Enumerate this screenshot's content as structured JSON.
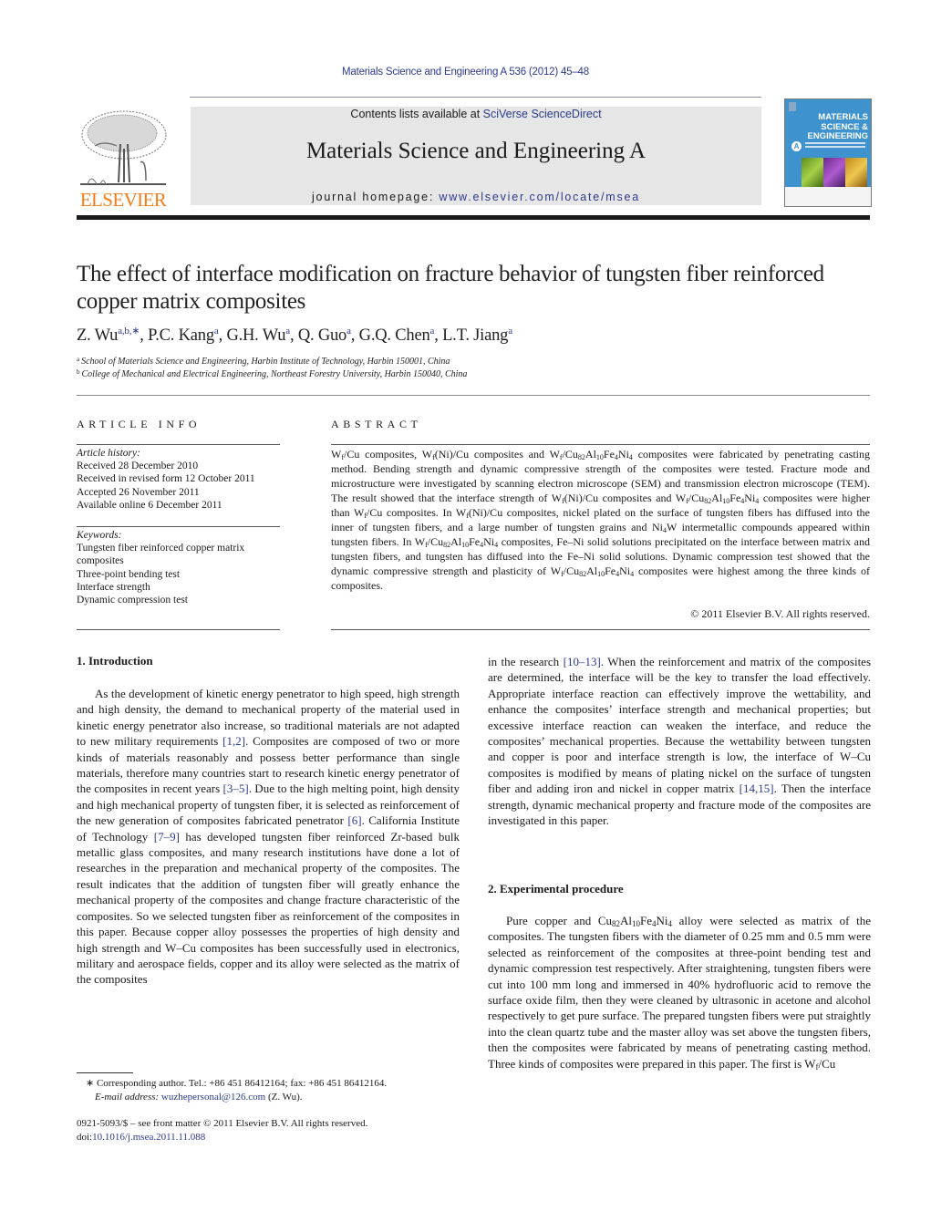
{
  "header": {
    "citation": "Materials Science and Engineering A 536 (2012) 45–48",
    "contents_prefix": "Contents lists available at ",
    "contents_link": "SciVerse ScienceDirect",
    "journal_name": "Materials Science and Engineering A",
    "homepage_prefix": "journal homepage: ",
    "homepage_link": "www.elsevier.com/locate/msea",
    "publisher_logo_text": "ELSEVIER",
    "cover": {
      "title_line1": "MATERIALS",
      "title_line2": "SCIENCE &",
      "title_line3": "ENGINEERING",
      "badge": "A"
    }
  },
  "article": {
    "title": "The effect of interface modification on fracture behavior of tungsten fiber reinforced copper matrix composites",
    "authors": [
      {
        "name": "Z. Wu",
        "sup": "a,b,∗"
      },
      {
        "name": "P.C. Kang",
        "sup": "a"
      },
      {
        "name": "G.H. Wu",
        "sup": "a"
      },
      {
        "name": "Q. Guo",
        "sup": "a"
      },
      {
        "name": "G.Q. Chen",
        "sup": "a"
      },
      {
        "name": "L.T. Jiang",
        "sup": "a"
      }
    ],
    "affiliations": [
      {
        "key": "a",
        "text": "School of Materials Science and Engineering, Harbin Institute of Technology, Harbin 150001, China"
      },
      {
        "key": "b",
        "text": "College of Mechanical and Electrical Engineering, Northeast Forestry University, Harbin 150040, China"
      }
    ]
  },
  "article_info": {
    "heading": "ARTICLE INFO",
    "history_label": "Article history:",
    "history": [
      "Received 28 December 2010",
      "Received in revised form 12 October 2011",
      "Accepted 26 November 2011",
      "Available online 6 December 2011"
    ],
    "keywords_label": "Keywords:",
    "keywords": [
      "Tungsten fiber reinforced copper matrix composites",
      "Three-point bending test",
      "Interface strength",
      "Dynamic compression test"
    ]
  },
  "abstract": {
    "heading": "ABSTRACT",
    "html": "W<sub>f</sub>/Cu composites, W<sub>f</sub>(Ni)/Cu composites and W<sub>f</sub>/Cu<sub>82</sub>Al<sub>10</sub>Fe<sub>4</sub>Ni<sub>4</sub> composites were fabricated by penetrating casting method. Bending strength and dynamic compressive strength of the composites were tested. Fracture mode and microstructure were investigated by scanning electron microscope (SEM) and transmission electron microscope (TEM). The result showed that the interface strength of W<sub>f</sub>(Ni)/Cu composites and W<sub>f</sub>/Cu<sub>82</sub>Al<sub>10</sub>Fe<sub>4</sub>Ni<sub>4</sub> composites were higher than W<sub>f</sub>/Cu composites. In W<sub>f</sub>(Ni)/Cu composites, nickel plated on the surface of tungsten fibers has diffused into the inner of tungsten fibers, and a large number of tungsten grains and Ni<sub>4</sub>W intermetallic compounds appeared within tungsten fibers. In W<sub>f</sub>/Cu<sub>82</sub>Al<sub>10</sub>Fe<sub>4</sub>Ni<sub>4</sub> composites, Fe–Ni solid solutions precipitated on the interface between matrix and tungsten fibers, and tungsten has diffused into the Fe–Ni solid solutions. Dynamic compression test showed that the dynamic compressive strength and plasticity of W<sub>f</sub>/Cu<sub>82</sub>Al<sub>10</sub>Fe<sub>4</sub>Ni<sub>4</sub> composites were highest among the three kinds of composites.",
    "copyright": "© 2011 Elsevier B.V. All rights reserved."
  },
  "sections": {
    "intro_heading": "1.  Introduction",
    "intro_html": "As the development of kinetic energy penetrator to high speed, high strength and high density, the demand to mechanical property of the material used in kinetic energy penetrator also increase, so traditional materials are not adapted to new military requirements <span class=\"ref\">[1,2]</span>. Composites are composed of two or more kinds of materials reasonably and possess better performance than single materials, therefore many countries start to research kinetic energy penetrator of the composites in recent years <span class=\"ref\">[3–5]</span>. Due to the high melting point, high density and high mechanical property of tungsten fiber, it is selected as reinforcement of the new generation of composites fabricated penetrator <span class=\"ref\">[6]</span>. California Institute of Technology <span class=\"ref\">[7–9]</span> has developed tungsten fiber reinforced Zr-based bulk metallic glass composites, and many research institutions have done a lot of researches in the preparation and mechanical property of the composites. The result indicates that the addition of tungsten fiber will greatly enhance the mechanical property of the composites and change fracture characteristic of the composites. So we selected tungsten fiber as reinforcement of the composites in this paper. Because copper alloy possesses the properties of high density and high strength and W–Cu composites has been successfully used in electronics, military and aerospace fields, copper and its alloy were selected as the matrix of the composites",
    "intro_cont_html": "in the research <span class=\"ref\">[10–13]</span>. When the reinforcement and matrix of the composites are determined, the interface will be the key to transfer the load effectively. Appropriate interface reaction can effectively improve the wettability, and enhance the composites’ interface strength and mechanical properties; but excessive interface reaction can weaken the interface, and reduce the composites’ mechanical properties. Because the wettability between tungsten and copper is poor and interface strength is low, the interface of W–Cu composites is modified by means of plating nickel on the surface of tungsten fiber and adding iron and nickel in copper matrix <span class=\"ref\">[14,15]</span>. Then the interface strength, dynamic mechanical property and fracture mode of the composites are investigated in this paper.",
    "exp_heading": "2.  Experimental procedure",
    "exp_html": "Pure copper and Cu<sub>82</sub>Al<sub>10</sub>Fe<sub>4</sub>Ni<sub>4</sub> alloy were selected as matrix of the composites. The tungsten fibers with the diameter of 0.25 mm and 0.5 mm were selected as reinforcement of the composites at three-point bending test and dynamic compression test respectively. After straightening, tungsten fibers were cut into 100 mm long and immersed in 40% hydrofluoric acid to remove the surface oxide film, then they were cleaned by ultrasonic in acetone and alcohol respectively to get pure surface. The prepared tungsten fibers were put straightly into the clean quartz tube and the master alloy was set above the tungsten fibers, then the composites were fabricated by means of penetrating casting method. Three kinds of composites were prepared in this paper. The first is W<sub>f</sub>/Cu"
  },
  "footnotes": {
    "corresponding": "∗ Corresponding author. Tel.: +86 451 86412164; fax: +86 451 86412164.",
    "email_label": "E-mail address:",
    "email": "wuzhepersonal@126.com",
    "email_suffix": " (Z. Wu).",
    "front_matter": "0921-5093/$ – see front matter © 2011 Elsevier B.V. All rights reserved.",
    "doi_prefix": "doi:",
    "doi": "10.1016/j.msea.2011.11.088"
  }
}
